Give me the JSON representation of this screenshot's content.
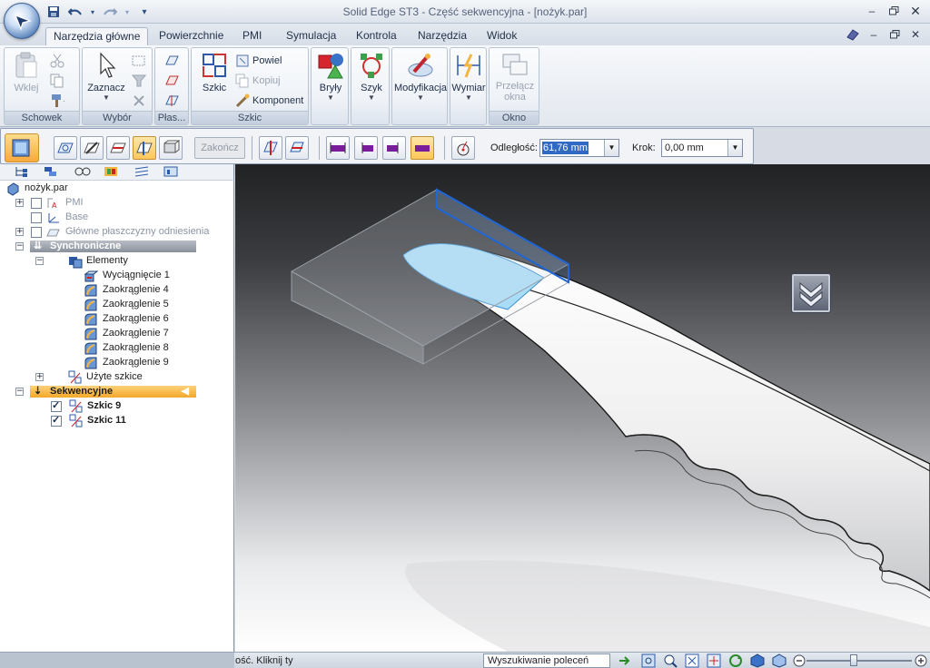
{
  "window": {
    "title": "Solid Edge ST3 - Część sekwencyjna - [nożyk.par]",
    "controls": [
      "minimize",
      "restore",
      "close"
    ]
  },
  "quick_access": [
    "save-icon",
    "undo-icon",
    "redo-icon",
    "customize-icon"
  ],
  "tabs": [
    {
      "label": "Narzędzia główne",
      "active": true
    },
    {
      "label": "Powierzchnie",
      "active": false
    },
    {
      "label": "PMI",
      "active": false
    },
    {
      "label": "Symulacja",
      "active": false
    },
    {
      "label": "Kontrola",
      "active": false
    },
    {
      "label": "Narzędzia",
      "active": false
    },
    {
      "label": "Widok",
      "active": false
    }
  ],
  "ribbon": {
    "clipboard": {
      "group_label": "Schowek",
      "paste_label": "Wklej"
    },
    "select": {
      "group_label": "Wybór",
      "select_label": "Zaznacz"
    },
    "planes": {
      "group_label": "Płas..."
    },
    "sketch": {
      "group_label": "Szkic",
      "sketch_label": "Szkic",
      "copy_label": "Powiel",
      "copy_disabled_label": "Kopiuj",
      "component_label": "Komponent"
    },
    "solids": {
      "label": "Bryły"
    },
    "pattern": {
      "label": "Szyk"
    },
    "modify": {
      "label": "Modyfikacja"
    },
    "dimension": {
      "label": "Wymiar"
    },
    "window": {
      "group_label": "Okno",
      "switch_label_1": "Przełącz",
      "switch_label_2": "okna"
    }
  },
  "command_bar": {
    "finish_label": "Zakończ",
    "distance_label": "Odległość:",
    "distance_value": "61,76 mm",
    "step_label": "Krok:",
    "step_value": "0,00 mm"
  },
  "tree": {
    "root": "nożyk.par",
    "pmi": "PMI",
    "base": "Base",
    "ref_planes": "Główne płaszczyzny odniesienia",
    "synchronous": "Synchroniczne",
    "features": "Elementy",
    "feature_items": [
      "Wyciągnięcie 1",
      "Zaokrąglenie 4",
      "Zaokrąglenie 5",
      "Zaokrąglenie 6",
      "Zaokrąglenie 7",
      "Zaokrąglenie 8",
      "Zaokrąglenie 9"
    ],
    "used_sketches": "Użyte szkice",
    "ordered": "Sekwencyjne",
    "sketches": [
      "Szkic 9",
      "Szkic 11"
    ]
  },
  "status": {
    "prompt": "ość. Kliknij ty",
    "command_search": "Wyszukiwanie poleceń"
  },
  "colors": {
    "accent_orange": "#f3a72a",
    "selection_blue": "#316ac5",
    "face_highlight": "#a8dcf7"
  }
}
